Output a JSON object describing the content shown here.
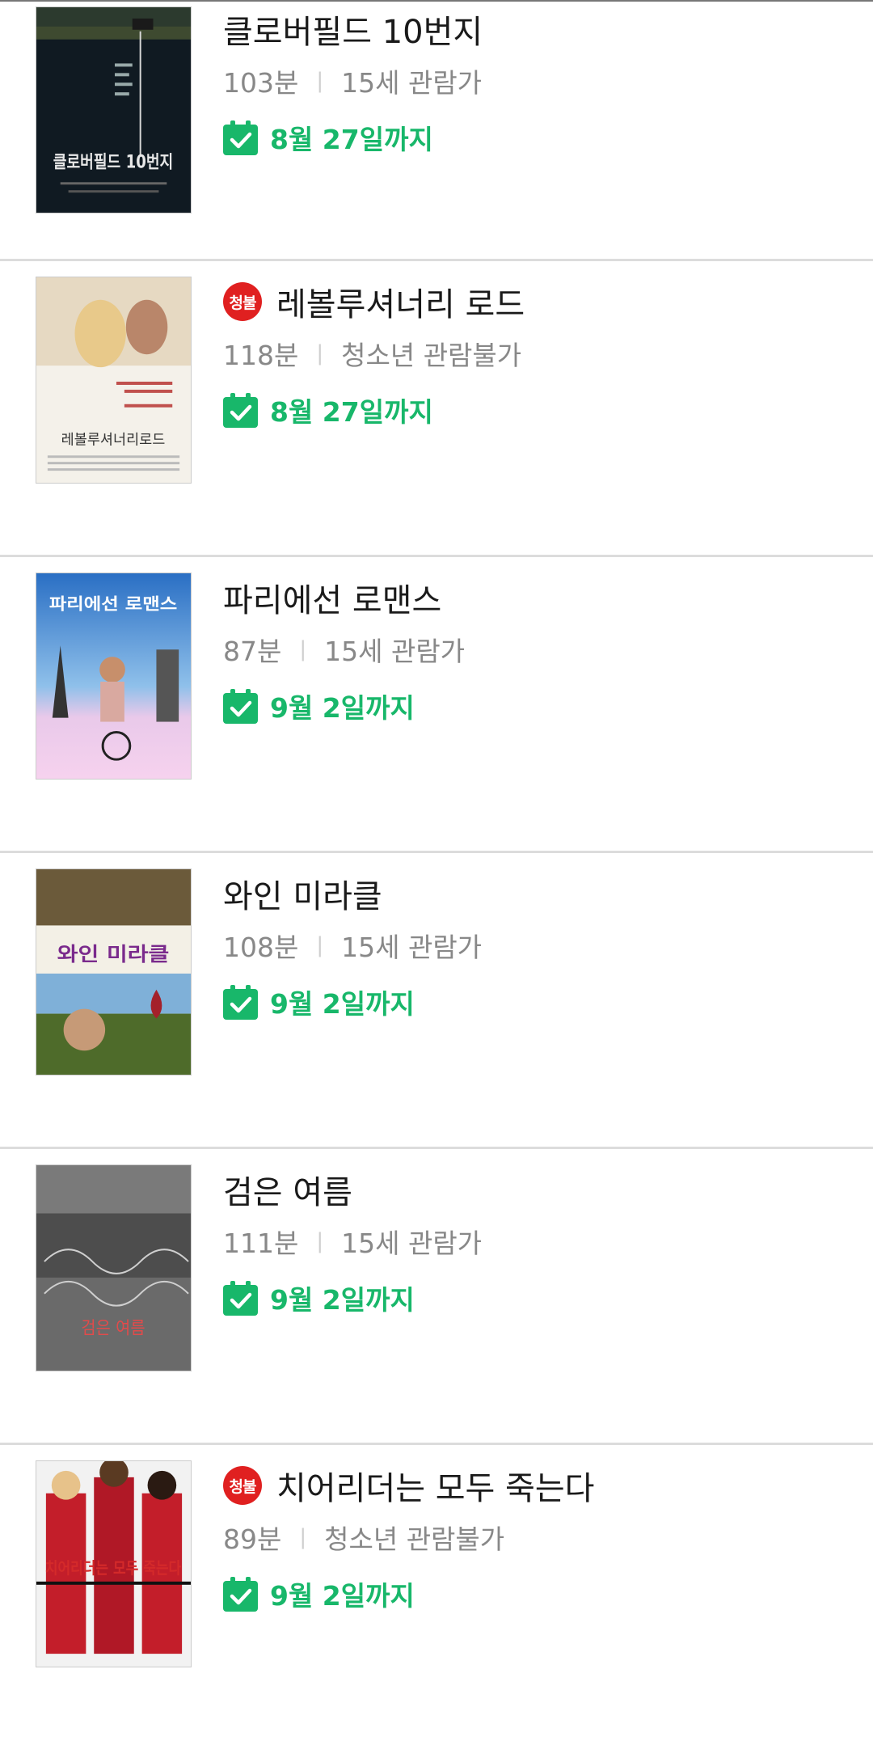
{
  "colors": {
    "accent": "#18b76a",
    "badge": "#e02020"
  },
  "movies": [
    {
      "title": "클로버필드 10번지",
      "runtime": "103분",
      "rating": "15세 관람가",
      "badge": "",
      "until": "8월 27일까지",
      "poster_text": "클로버필드 10번지"
    },
    {
      "title": "레볼루셔너리 로드",
      "runtime": "118분",
      "rating": "청소년 관람불가",
      "badge": "청불",
      "until": "8월 27일까지",
      "poster_text": "레볼루셔너리로드"
    },
    {
      "title": "파리에선 로맨스",
      "runtime": "87분",
      "rating": "15세 관람가",
      "badge": "",
      "until": "9월 2일까지",
      "poster_text": "파리에선 로맨스"
    },
    {
      "title": "와인 미라클",
      "runtime": "108분",
      "rating": "15세 관람가",
      "badge": "",
      "until": "9월 2일까지",
      "poster_text": "와인 미라클"
    },
    {
      "title": "검은 여름",
      "runtime": "111분",
      "rating": "15세 관람가",
      "badge": "",
      "until": "9월 2일까지",
      "poster_text": "검은 여름"
    },
    {
      "title": "치어리더는 모두 죽는다",
      "runtime": "89분",
      "rating": "청소년 관람불가",
      "badge": "청불",
      "until": "9월 2일까지",
      "poster_text": "치어리더는 모두 죽는다"
    }
  ]
}
